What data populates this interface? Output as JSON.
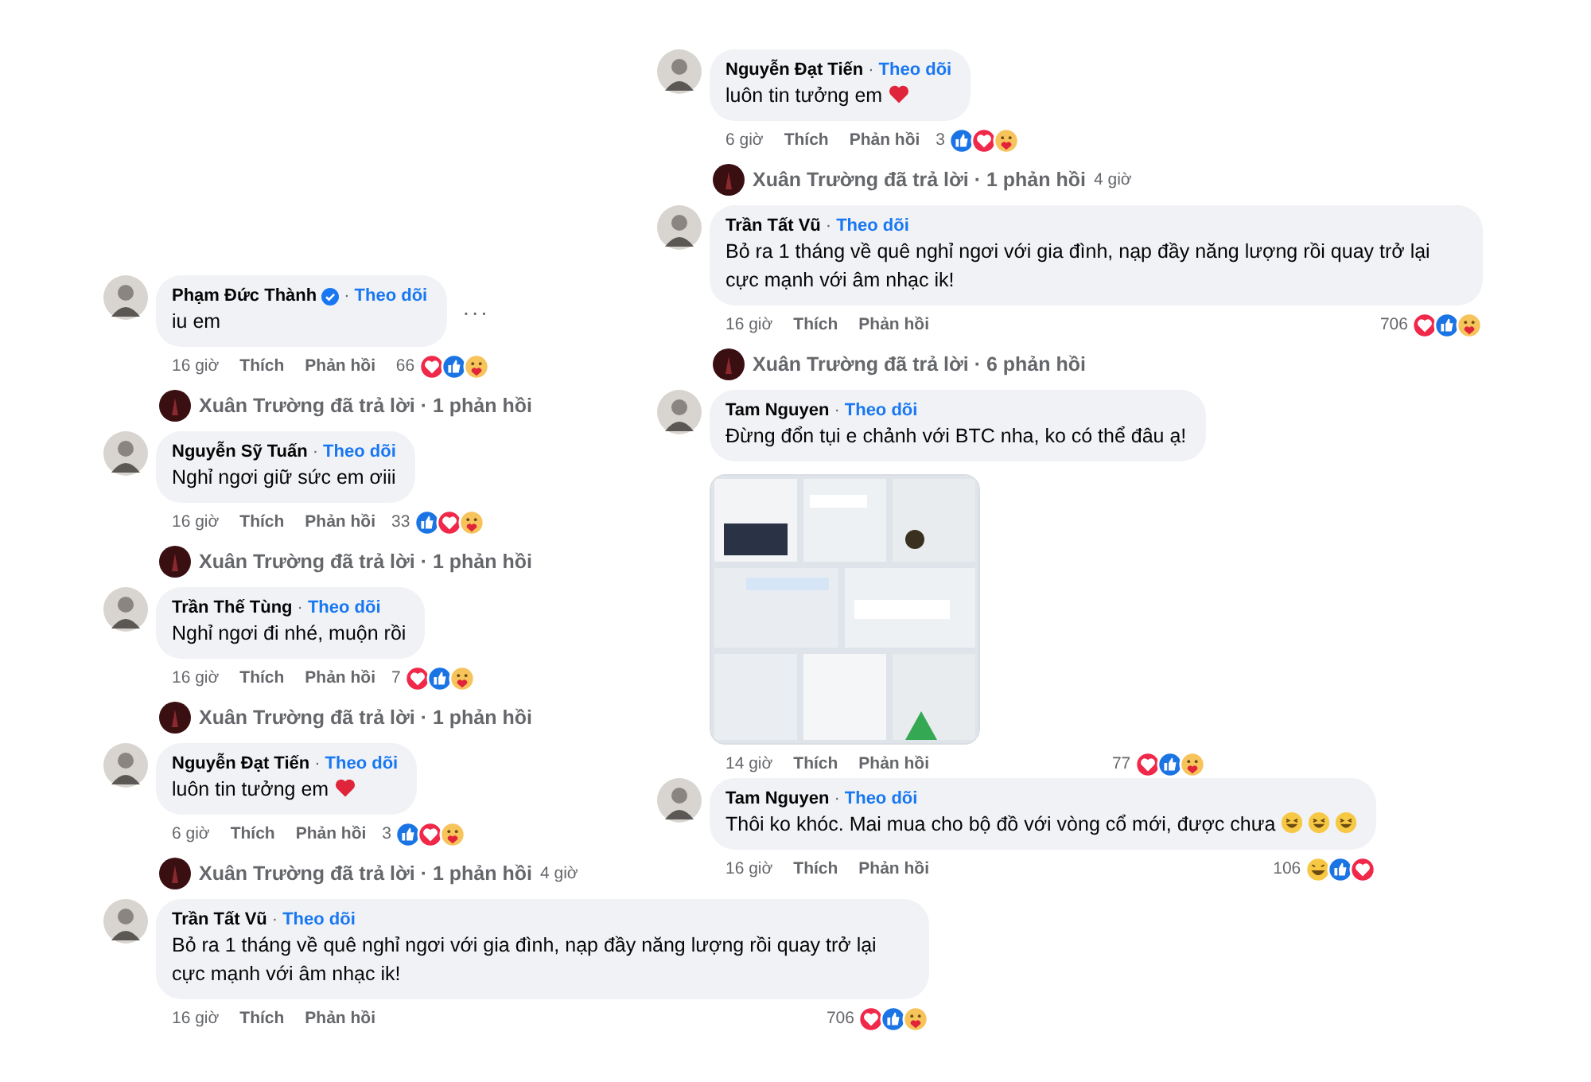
{
  "panels": [
    {
      "items": [
        {
          "kind": "comment",
          "name": "Phạm Đức Thành",
          "verified": true,
          "separator": "·",
          "follow": "Theo dõi",
          "text": "iu em",
          "more": "···",
          "time": "16 giờ",
          "like": "Thích",
          "reply": "Phản hồi",
          "count": "66",
          "reactions": [
            {
              "kind": "love"
            },
            {
              "kind": "like"
            },
            {
              "kind": "care"
            }
          ]
        },
        {
          "kind": "replies",
          "text": "Xuân Trường đã trả lời · 1 phản hồi"
        },
        {
          "kind": "comment",
          "name": "Nguyễn Sỹ Tuấn",
          "verified": false,
          "separator": "·",
          "follow": "Theo dõi",
          "text": "Nghỉ ngơi giữ sức em ơiii",
          "time": "16 giờ",
          "like": "Thích",
          "reply": "Phản hồi",
          "count": "33",
          "reactions": [
            {
              "kind": "like"
            },
            {
              "kind": "love"
            },
            {
              "kind": "care"
            }
          ]
        },
        {
          "kind": "replies",
          "text": "Xuân Trường đã trả lời · 1 phản hồi"
        },
        {
          "kind": "comment",
          "name": "Trần Thế Tùng",
          "verified": false,
          "separator": "·",
          "follow": "Theo dõi",
          "text": "Nghỉ ngơi đi nhé, muộn rồi",
          "time": "16 giờ",
          "like": "Thích",
          "reply": "Phản hồi",
          "count": "7",
          "reactions": [
            {
              "kind": "love"
            },
            {
              "kind": "like"
            },
            {
              "kind": "care"
            }
          ]
        },
        {
          "kind": "replies",
          "text": "Xuân Trường đã trả lời · 1 phản hồi"
        },
        {
          "kind": "comment",
          "name": "Nguyễn Đạt Tiến",
          "verified": false,
          "separator": "·",
          "follow": "Theo dõi",
          "text": "luôn tin tưởng em",
          "emojis": [
            {
              "kind": "heart"
            }
          ],
          "time": "6 giờ",
          "like": "Thích",
          "reply": "Phản hồi",
          "count": "3",
          "reactions": [
            {
              "kind": "like"
            },
            {
              "kind": "love"
            },
            {
              "kind": "care"
            }
          ]
        },
        {
          "kind": "replies",
          "text": "Xuân Trường đã trả lời · 1 phản hồi",
          "time": "4 giờ"
        },
        {
          "kind": "comment",
          "name": "Trần Tất Vũ",
          "verified": false,
          "separator": "·",
          "follow": "Theo dõi",
          "text": "Bỏ ra 1 tháng về quê nghỉ ngơi với gia đình, nạp đầy năng lượng rồi quay trở lại cực mạnh với âm nhạc ik!",
          "time": "16 giờ",
          "like": "Thích",
          "reply": "Phản hồi",
          "count": "706",
          "reactions": [
            {
              "kind": "love"
            },
            {
              "kind": "like"
            },
            {
              "kind": "care"
            }
          ]
        }
      ]
    },
    {
      "items": [
        {
          "kind": "comment",
          "name": "Nguyễn Đạt Tiến",
          "verified": false,
          "separator": "·",
          "follow": "Theo dõi",
          "text": "luôn tin tưởng em",
          "emojis": [
            {
              "kind": "heart"
            }
          ],
          "time": "6 giờ",
          "like": "Thích",
          "reply": "Phản hồi",
          "count": "3",
          "reactions": [
            {
              "kind": "like"
            },
            {
              "kind": "love"
            },
            {
              "kind": "care"
            }
          ]
        },
        {
          "kind": "replies",
          "text": "Xuân Trường đã trả lời · 1 phản hồi",
          "time": "4 giờ"
        },
        {
          "kind": "comment",
          "name": "Trần Tất Vũ",
          "verified": false,
          "separator": "·",
          "follow": "Theo dõi",
          "text": "Bỏ ra 1 tháng về quê nghỉ ngơi với gia đình, nạp đầy năng lượng rồi quay trở lại cực mạnh với âm nhạc ik!",
          "time": "16 giờ",
          "like": "Thích",
          "reply": "Phản hồi",
          "count": "706",
          "reactions": [
            {
              "kind": "love"
            },
            {
              "kind": "like"
            },
            {
              "kind": "care"
            }
          ]
        },
        {
          "kind": "replies",
          "text": "Xuân Trường đã trả lời · 6 phản hồi"
        },
        {
          "kind": "comment",
          "name": "Tam Nguyen",
          "verified": false,
          "separator": "·",
          "follow": "Theo dõi",
          "text": "Đừng đổn tụi e chảnh với BTC nha, ko có thể đâu ạ!",
          "time": "14 giờ",
          "like": "Thích",
          "reply": "Phản hồi",
          "count": "77",
          "reactions": [
            {
              "kind": "love"
            },
            {
              "kind": "like"
            },
            {
              "kind": "care"
            }
          ]
        },
        {
          "kind": "comment",
          "name": "Tam Nguyen",
          "verified": false,
          "separator": "·",
          "follow": "Theo dõi",
          "text": "Thôi ko khóc. Mai mua cho bộ đồ với vòng cổ mới, được chưa",
          "emojis": [
            {
              "kind": "laugh"
            },
            {
              "kind": "laugh"
            },
            {
              "kind": "laugh"
            }
          ],
          "time": "16 giờ",
          "like": "Thích",
          "reply": "Phản hồi",
          "count": "106",
          "reactions": [
            {
              "kind": "haha"
            },
            {
              "kind": "like"
            },
            {
              "kind": "love"
            }
          ]
        }
      ]
    }
  ]
}
